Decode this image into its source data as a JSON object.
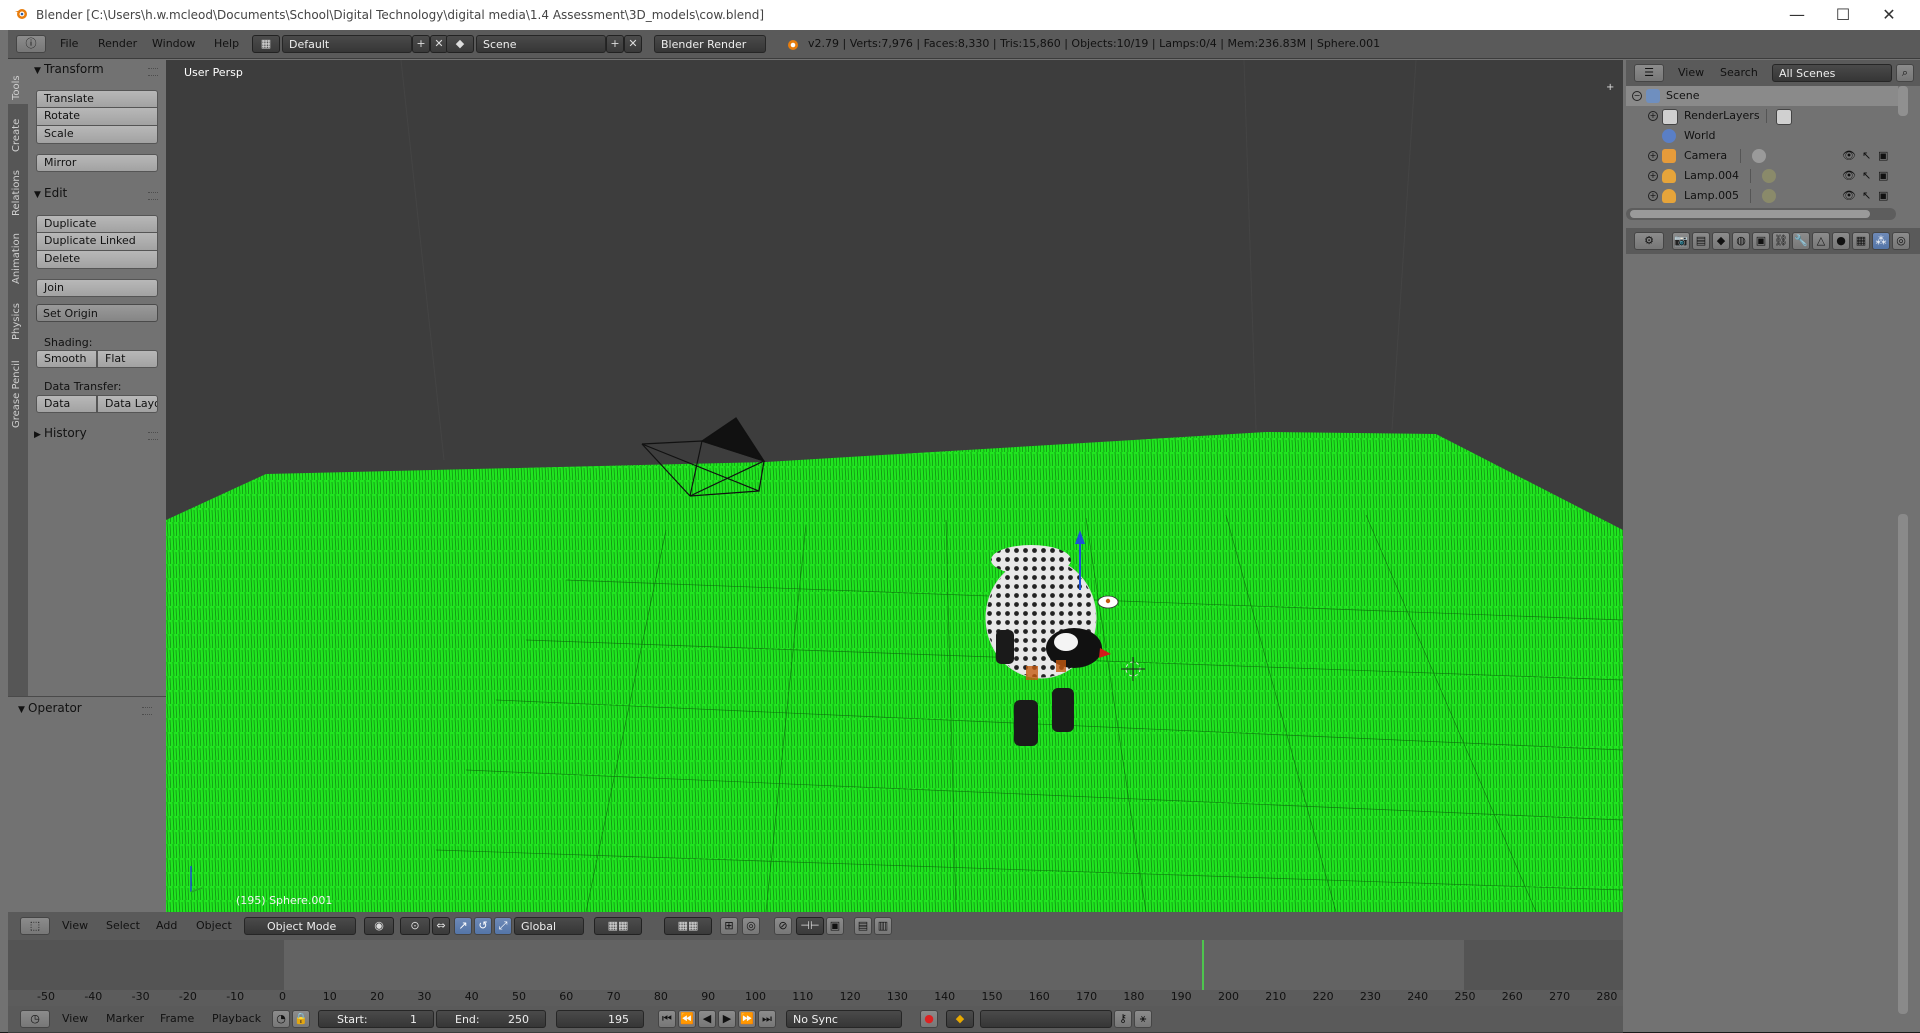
{
  "window": {
    "title": "Blender [C:\\Users\\h.w.mcleod\\Documents\\School\\Digital Technology\\digital media\\1.4 Assessment\\3D_models\\cow.blend]",
    "min_glyph": "—",
    "max_glyph": "☐",
    "close_glyph": "✕"
  },
  "info_header": {
    "menus": [
      "File",
      "Render",
      "Window",
      "Help"
    ],
    "layout": "Default",
    "scene": "Scene",
    "engine": "Blender Render",
    "stats": "v2.79 | Verts:7,976 | Faces:8,330 | Tris:15,860 | Objects:10/19 | Lamps:0/4 | Mem:236.83M | Sphere.001"
  },
  "tool_tabs": [
    "Tools",
    "Create",
    "Relations",
    "Animation",
    "Physics",
    "Grease Pencil"
  ],
  "tool_shelf": {
    "transform": {
      "heading": "Transform",
      "buttons": [
        "Translate",
        "Rotate",
        "Scale",
        "Mirror"
      ]
    },
    "edit": {
      "heading": "Edit",
      "buttons": [
        "Duplicate",
        "Duplicate Linked",
        "Delete",
        "Join"
      ],
      "set_origin": "Set Origin",
      "shading_label": "Shading:",
      "smooth": "Smooth",
      "flat": "Flat",
      "data_transfer_label": "Data Transfer:",
      "data": "Data",
      "data_layout": "Data Layo"
    },
    "history": {
      "heading": "History"
    },
    "operator": {
      "heading": "Operator"
    }
  },
  "viewport": {
    "view_name": "User Persp",
    "object_info": "(195) Sphere.001",
    "grass_color": "#1be21b"
  },
  "viewport_header": {
    "menus": [
      "View",
      "Select",
      "Add",
      "Object"
    ],
    "mode": "Object Mode",
    "orientation": "Global"
  },
  "timeline": {
    "ruler": [
      "-50",
      "-40",
      "-30",
      "-20",
      "-10",
      "0",
      "10",
      "20",
      "30",
      "40",
      "50",
      "60",
      "70",
      "80",
      "90",
      "100",
      "110",
      "120",
      "130",
      "140",
      "150",
      "160",
      "170",
      "180",
      "190",
      "200",
      "210",
      "220",
      "230",
      "240",
      "250",
      "260",
      "270",
      "280"
    ],
    "menus": [
      "View",
      "Marker",
      "Frame",
      "Playback"
    ],
    "start_label": "Start:",
    "start_value": "1",
    "end_label": "End:",
    "end_value": "250",
    "current_frame": "195",
    "sync": "No Sync"
  },
  "outliner": {
    "header_menus": [
      "View",
      "Search"
    ],
    "filter": "All Scenes",
    "items": [
      {
        "label": "Scene"
      },
      {
        "label": "RenderLayers"
      },
      {
        "label": "World"
      },
      {
        "label": "Camera"
      },
      {
        "label": "Lamp.004"
      },
      {
        "label": "Lamp.005"
      }
    ]
  }
}
